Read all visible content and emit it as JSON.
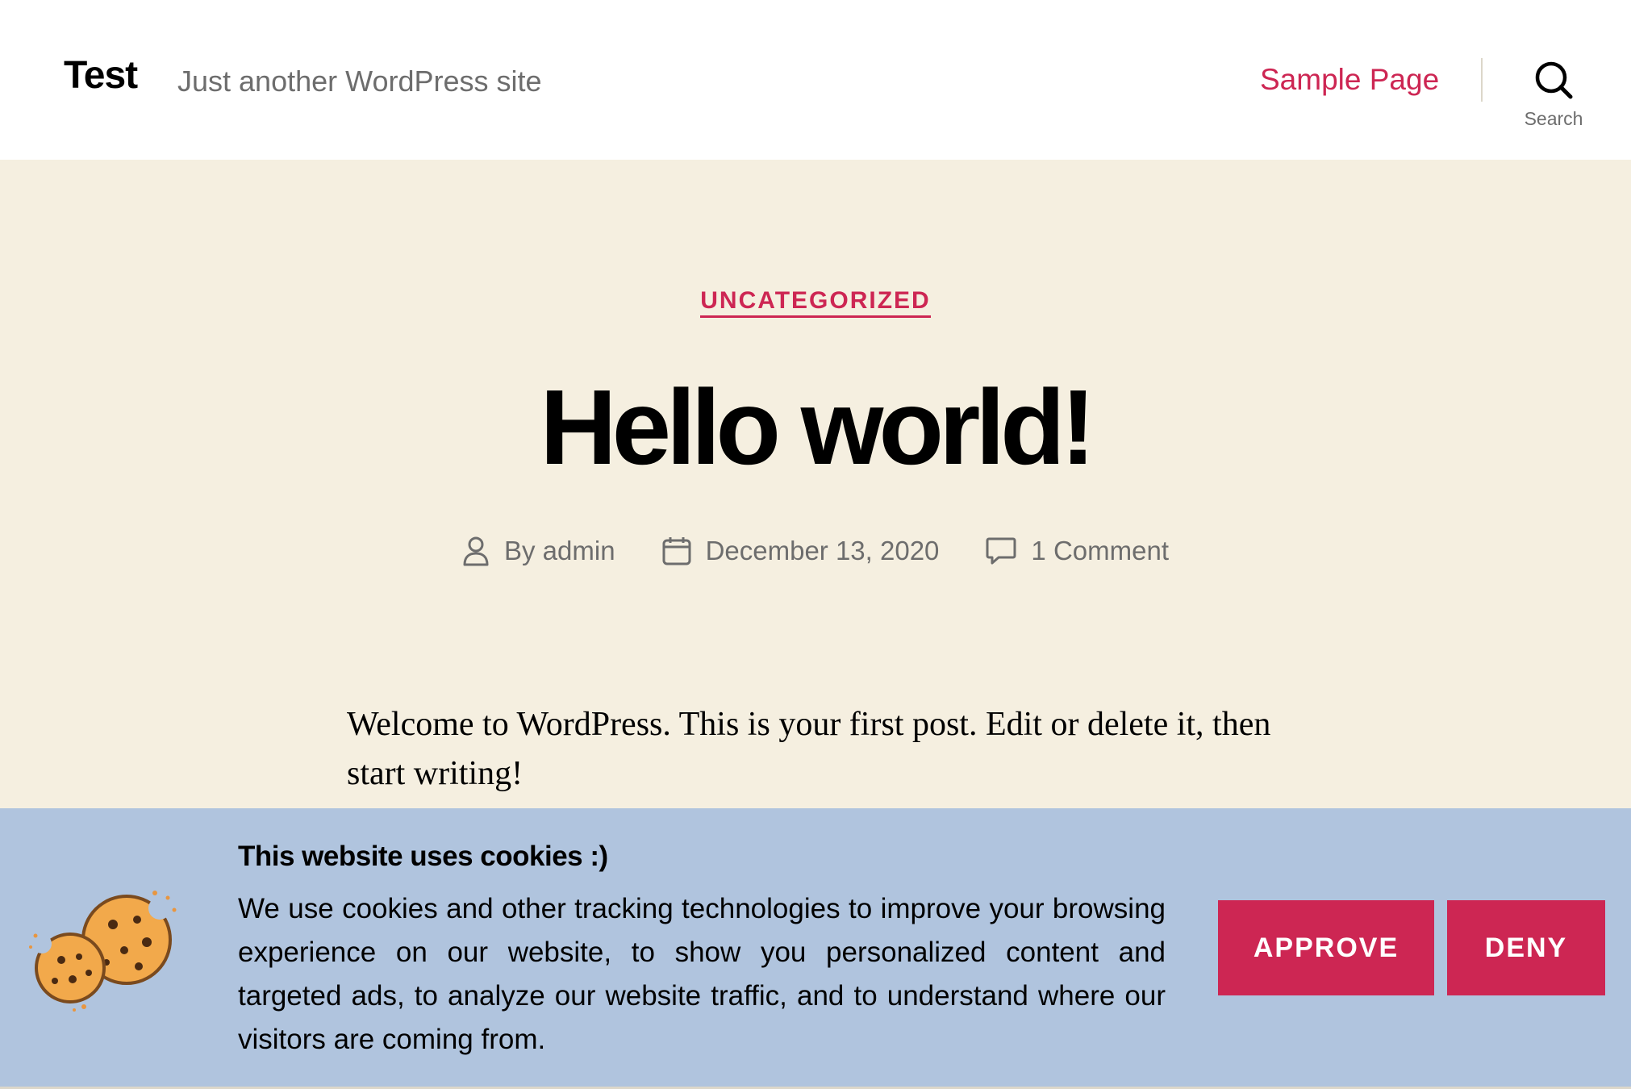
{
  "header": {
    "site_title": "Test",
    "tagline": "Just another WordPress site",
    "nav": [
      {
        "label": "Sample Page"
      }
    ],
    "search_label": "Search"
  },
  "post": {
    "category": "UNCATEGORIZED",
    "title": "Hello world!",
    "author": "By admin",
    "date": "December 13, 2020",
    "comments": "1 Comment",
    "content": "Welcome to WordPress. This is your first post. Edit or delete it, then start writing!"
  },
  "cookie_banner": {
    "title": "This website uses cookies :)",
    "text": "We use cookies and other tracking technologies to improve your browsing experience on our website, to show you personalized content and targeted ads, to analyze our website traffic, and to understand where our visitors are coming from.",
    "approve_label": "APPROVE",
    "deny_label": "DENY",
    "icon": "cookie-icon"
  },
  "colors": {
    "accent": "#cd2653",
    "background": "#f5efe0",
    "banner": "#b0c4de",
    "muted_text": "#6d6d6d"
  }
}
